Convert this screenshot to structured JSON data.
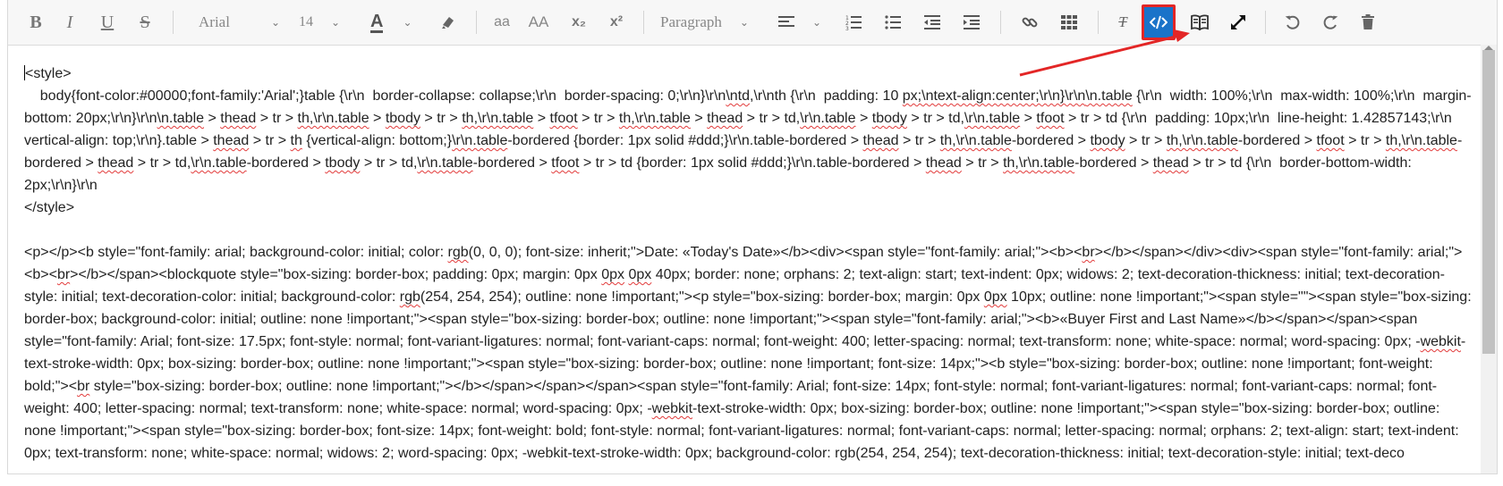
{
  "toolbar": {
    "font_family": "Arial",
    "font_size": "14",
    "font_color_letter": "A",
    "case_lower": "aa",
    "case_upper": "AA",
    "subscript": "x₂",
    "superscript": "x²",
    "paragraph": "Paragraph",
    "bold": "B",
    "italic": "I",
    "underline": "U",
    "strike": "S",
    "clear_format": "T"
  },
  "editor": {
    "style_open": "<style>",
    "style_body_segments": [
      {
        "t": "    body{font-color:#00000;font-family:'Arial';}table {\\r\\n  border-collapse: collapse;\\r\\n  border-spacing: 0;\\r\\n}\\r\\n"
      },
      {
        "t": "\\ntd",
        "s": true
      },
      {
        "t": ",\\r\\nth {\\r\\n  padding: 10 "
      },
      {
        "t": "px;\\ntext-align:center;\\r\\n}\\r\\n",
        "s": true
      },
      {
        "t": "\\n.table",
        "s": true
      },
      {
        "t": " {\\r\\n  width: 100%;\\r\\n  max-width: 100%;\\r\\n  margin-bottom: 20px;\\r\\n}\\r\\n"
      },
      {
        "t": "\\n.table",
        "s": true
      },
      {
        "t": " > "
      },
      {
        "t": "thead",
        "s": true
      },
      {
        "t": " > tr > "
      },
      {
        "t": "th,\\r\\n.table",
        "s": true
      },
      {
        "t": " > "
      },
      {
        "t": "tbody",
        "s": true
      },
      {
        "t": " > tr > "
      },
      {
        "t": "th,\\r\\n.table",
        "s": true
      },
      {
        "t": " > "
      },
      {
        "t": "tfoot",
        "s": true
      },
      {
        "t": " > tr > "
      },
      {
        "t": "th,\\r\\n.table",
        "s": true
      },
      {
        "t": " > "
      },
      {
        "t": "thead",
        "s": true
      },
      {
        "t": " > tr > td,"
      },
      {
        "t": "\\r\\n.table",
        "s": true
      },
      {
        "t": " > "
      },
      {
        "t": "tbody",
        "s": true
      },
      {
        "t": " > tr > td,"
      },
      {
        "t": "\\r\\n.table",
        "s": true
      },
      {
        "t": " > "
      },
      {
        "t": "tfoot",
        "s": true
      },
      {
        "t": " > tr > td {\\r\\n  padding: 10px;\\r\\n  line-height: 1.42857143;\\r\\n  vertical-align: top;\\r\\n}.table > "
      },
      {
        "t": "thead",
        "s": true
      },
      {
        "t": " > tr > "
      },
      {
        "t": "th",
        "s": true
      },
      {
        "t": " {vertical-align: bottom;}"
      },
      {
        "t": "\\r\\n.table",
        "s": true
      },
      {
        "t": "-bordered {border: 1px solid #ddd;}\\r\\n.table-bordered > "
      },
      {
        "t": "thead",
        "s": true
      },
      {
        "t": " > tr > "
      },
      {
        "t": "th,\\r\\n.table",
        "s": true
      },
      {
        "t": "-bordered > "
      },
      {
        "t": "tbody",
        "s": true
      },
      {
        "t": " > tr > "
      },
      {
        "t": "th,\\r\\n.table",
        "s": true
      },
      {
        "t": "-bordered > "
      },
      {
        "t": "tfoot",
        "s": true
      },
      {
        "t": " > tr > "
      },
      {
        "t": "th,\\r\\n.table",
        "s": true
      },
      {
        "t": "-bordered > "
      },
      {
        "t": "thead",
        "s": true
      },
      {
        "t": " > tr > td,"
      },
      {
        "t": "\\r\\n.table",
        "s": true
      },
      {
        "t": "-bordered > "
      },
      {
        "t": "tbody",
        "s": true
      },
      {
        "t": " > tr > td,"
      },
      {
        "t": "\\r\\n.table",
        "s": true
      },
      {
        "t": "-bordered > "
      },
      {
        "t": "tfoot",
        "s": true
      },
      {
        "t": " > tr > td {border: 1px solid #ddd;}\\r\\n.table-bordered > "
      },
      {
        "t": "thead",
        "s": true
      },
      {
        "t": " > tr > "
      },
      {
        "t": "th,\\r\\n.table",
        "s": true
      },
      {
        "t": "-bordered > "
      },
      {
        "t": "thead",
        "s": true
      },
      {
        "t": " > tr > td {\\r\\n  border-bottom-width: 2px;\\r\\n}\\r\\n"
      }
    ],
    "style_close": "</style>",
    "html_segments": [
      {
        "t": "<p></p><b style=\"font-family: arial; background-color: initial; color: "
      },
      {
        "t": "rgb",
        "s": true
      },
      {
        "t": "(0, 0, 0); font-size: inherit;\">Date: «Today's Date»</b><div><span style=\"font-family: arial;\"><b><"
      },
      {
        "t": "br",
        "s": true
      },
      {
        "t": "></b></span></div><div><span style=\"font-family: arial;\"><b><"
      },
      {
        "t": "br",
        "s": true
      },
      {
        "t": "></b></span><blockquote style=\"box-sizing: border-box; padding: 0px; margin: 0px "
      },
      {
        "t": "0px",
        "s": true
      },
      {
        "t": " "
      },
      {
        "t": "0px",
        "s": true
      },
      {
        "t": " 40px; border: none; orphans: 2; text-align: start; text-indent: 0px; widows: 2; text-decoration-thickness: initial; text-decoration-style: initial; text-decoration-color: initial; background-color: "
      },
      {
        "t": "rgb",
        "s": true
      },
      {
        "t": "(254, 254, 254); outline: none !important;\"><p style=\"box-sizing: border-box; margin: 0px "
      },
      {
        "t": "0px",
        "s": true
      },
      {
        "t": " 10px; outline: none !important;\"><span style=\"\"><span style=\"box-sizing: border-box; background-color: initial; outline: none !important;\"><span style=\"box-sizing: border-box; outline: none !important;\"><span style=\"font-family: arial;\"><b>«Buyer First and Last Name»</b></span></span><span style=\"font-family: Arial; font-size: 17.5px; font-style: normal; font-variant-ligatures: normal; font-variant-caps: normal; font-weight: 400; letter-spacing: normal; text-transform: none; white-space: normal; word-spacing: 0px; -"
      },
      {
        "t": "webkit",
        "s": true
      },
      {
        "t": "-text-stroke-width: 0px; box-sizing: border-box; outline: none !important;\"><span style=\"box-sizing: border-box; outline: none !important; font-size: 14px;\"><b style=\"box-sizing: border-box; outline: none !important; font-weight: bold;\"><"
      },
      {
        "t": "br",
        "s": true
      },
      {
        "t": " style=\"box-sizing: border-box; outline: none !important;\"></b></span></span></span><span style=\"font-family: Arial; font-size: 14px; font-style: normal; font-variant-ligatures: normal; font-variant-caps: normal; font-weight: 400; letter-spacing: normal; text-transform: none; white-space: normal; word-spacing: 0px; -"
      },
      {
        "t": "webkit",
        "s": true
      },
      {
        "t": "-text-stroke-width: 0px; box-sizing: border-box; outline: none !important;\"><span style=\"box-sizing: border-box; outline: none !important;\"><span style=\"box-sizing: border-box; font-size: 14px; font-weight: bold; font-style: normal; font-variant-ligatures: normal; font-variant-caps: normal; letter-spacing: normal; orphans: 2; text-align: start; text-indent: 0px; text-transform: none; white-space: normal; widows: 2; word-spacing: 0px; -webkit-text-stroke-width: 0px; background-color: rgb(254, 254, 254); text-decoration-thickness: initial; text-decoration-style: initial; text-deco"
      }
    ]
  },
  "colors": {
    "toolbar_bg": "#f7f7f7",
    "active_button_bg": "#1a73c9",
    "highlight_border": "#e32626",
    "annotation_arrow": "#e32626",
    "spellcheck_underline": "#e23b3b"
  },
  "icons": [
    "bold-icon",
    "italic-icon",
    "underline-icon",
    "strikethrough-icon",
    "font-color-icon",
    "highlight-icon",
    "subscript-icon",
    "superscript-icon",
    "align-left-icon",
    "ordered-list-icon",
    "unordered-list-icon",
    "outdent-icon",
    "indent-icon",
    "link-icon",
    "table-icon",
    "clear-format-icon",
    "code-view-icon",
    "book-icon",
    "fullscreen-icon",
    "undo-icon",
    "redo-icon",
    "trash-icon"
  ]
}
